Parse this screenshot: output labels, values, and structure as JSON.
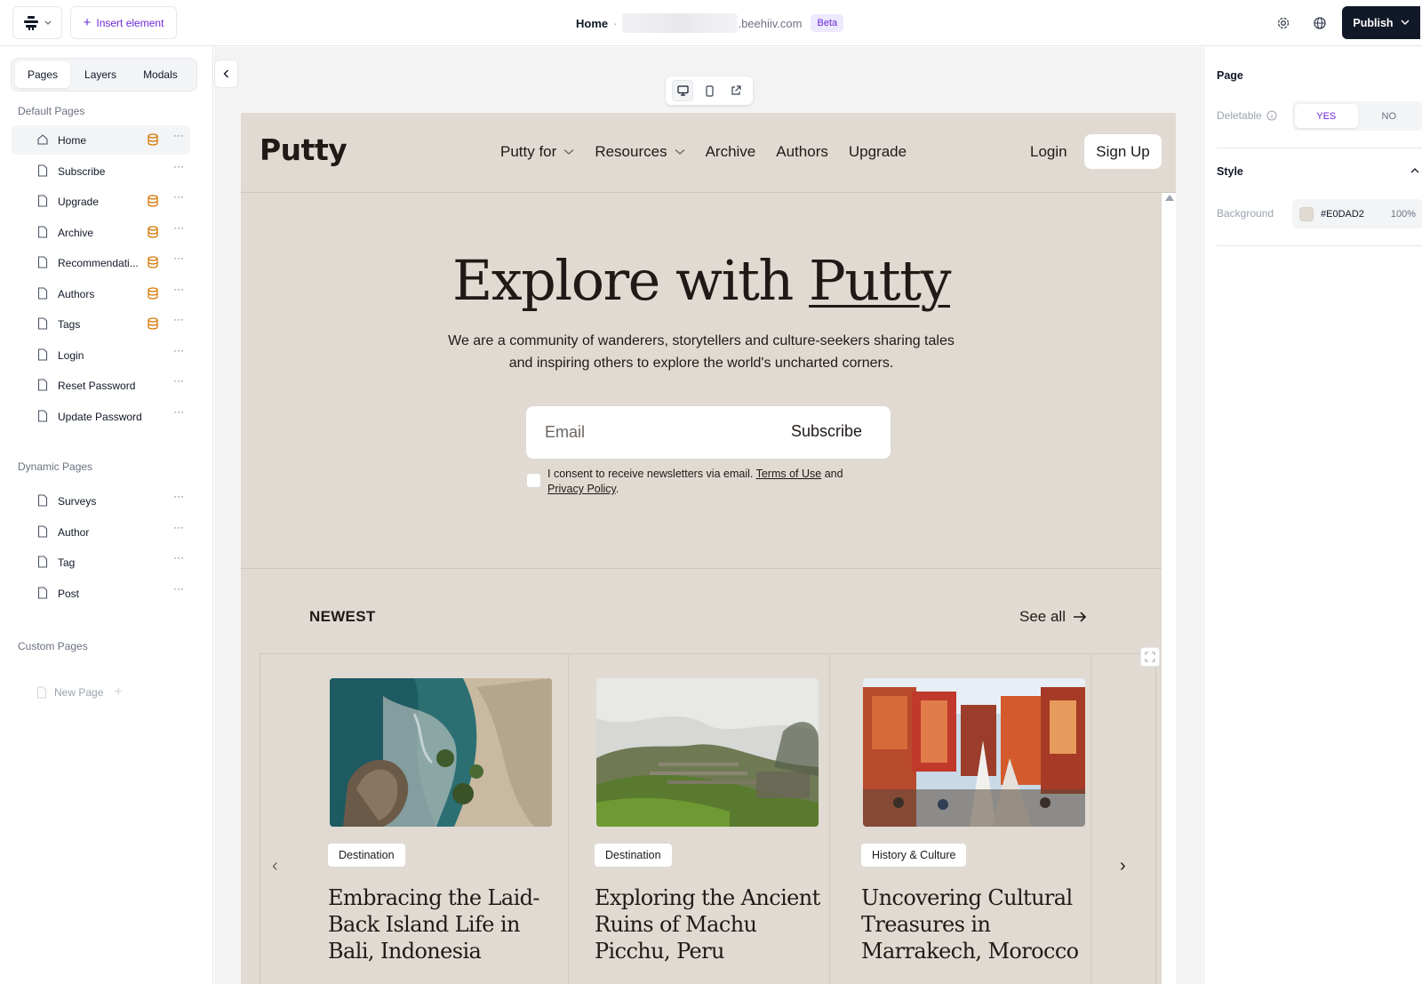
{
  "topbar": {
    "insert_label": "Insert element",
    "crumb_page": "Home",
    "crumb_dot": "·",
    "crumb_domain": ".beehiiv.com",
    "beta": "Beta",
    "publish_label": "Publish",
    "icons": [
      "settings-icon",
      "globe-icon"
    ]
  },
  "sidebar": {
    "tabs": [
      {
        "label": "Pages",
        "active": true
      },
      {
        "label": "Layers",
        "active": false
      },
      {
        "label": "Modals",
        "active": false
      }
    ],
    "default_label": "Default Pages",
    "default_pages": [
      {
        "label": "Home",
        "icon": "home-icon",
        "premium": true,
        "active": true
      },
      {
        "label": "Subscribe",
        "icon": "file-icon",
        "premium": false
      },
      {
        "label": "Upgrade",
        "icon": "file-icon",
        "premium": true
      },
      {
        "label": "Archive",
        "icon": "file-icon",
        "premium": true
      },
      {
        "label": "Recommendati...",
        "icon": "file-icon",
        "premium": true
      },
      {
        "label": "Authors",
        "icon": "file-icon",
        "premium": true
      },
      {
        "label": "Tags",
        "icon": "file-icon",
        "premium": true
      },
      {
        "label": "Login",
        "icon": "file-icon",
        "premium": false
      },
      {
        "label": "Reset Password",
        "icon": "file-icon",
        "premium": false
      },
      {
        "label": "Update Password",
        "icon": "file-icon",
        "premium": false
      }
    ],
    "dynamic_label": "Dynamic Pages",
    "dynamic_pages": [
      {
        "label": "Surveys"
      },
      {
        "label": "Author"
      },
      {
        "label": "Tag"
      },
      {
        "label": "Post"
      }
    ],
    "custom_label": "Custom Pages",
    "new_page_label": "New Page",
    "more_glyph": "···"
  },
  "site": {
    "brand": "Putty",
    "nav": [
      {
        "label": "Putty for",
        "dropdown": true
      },
      {
        "label": "Resources",
        "dropdown": true
      },
      {
        "label": "Archive",
        "dropdown": false
      },
      {
        "label": "Authors",
        "dropdown": false
      },
      {
        "label": "Upgrade",
        "dropdown": false
      }
    ],
    "login": "Login",
    "signup": "Sign Up",
    "hero": {
      "title_plain": "Explore with ",
      "title_underlined": "Putty",
      "subtitle": "We are a community of wanderers, storytellers and culture-seekers sharing tales and inspiring others to explore the world's uncharted corners.",
      "email_placeholder": "Email",
      "subscribe": "Subscribe",
      "consent_pre": "I consent to receive newsletters via email. ",
      "terms": "Terms of Use",
      "consent_mid": " and ",
      "privacy": "Privacy Policy",
      "consent_end": "."
    },
    "newest_label": "NEWEST",
    "see_all": "See all",
    "cards": [
      {
        "tag": "Destination",
        "title": "Embracing the Laid-Back Island Life in Bali, Indonesia",
        "image": "coastal-cliff-photo"
      },
      {
        "tag": "Destination",
        "title": "Exploring the Ancient Ruins of Machu Picchu, Peru",
        "image": "machu-picchu-photo"
      },
      {
        "tag": "History & Culture",
        "title": "Uncovering Cultural Treasures in Marrakech, Morocco",
        "image": "marrakech-market-photo"
      }
    ]
  },
  "rpanel": {
    "page_heading": "Page",
    "deletable_label": "Deletable",
    "yes": "YES",
    "no": "NO",
    "deletable_value": "YES",
    "style_heading": "Style",
    "background_label": "Background",
    "background_hex": "#E0DAD2",
    "background_opacity": "100%"
  },
  "colors": {
    "site_background": "#E0DAD2",
    "accent": "#6d28d9",
    "premium_icon": "#d97706",
    "publish_bg": "#111827"
  }
}
